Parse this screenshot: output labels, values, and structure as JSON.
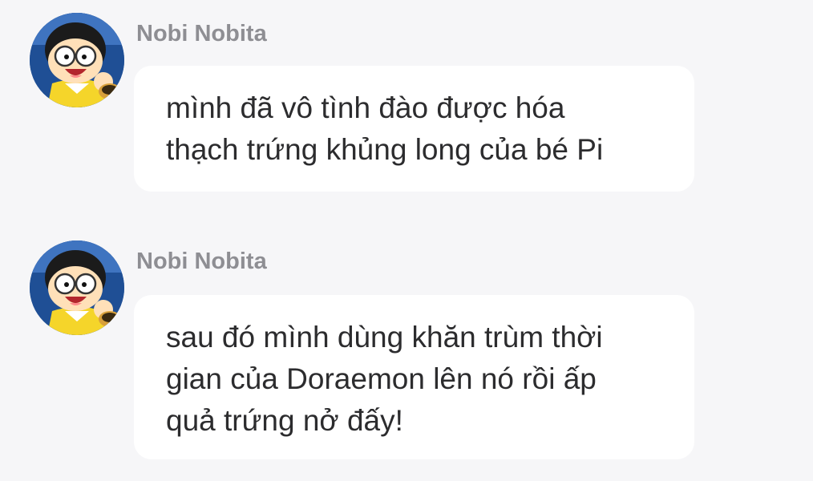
{
  "messages": [
    {
      "sender": "Nobi Nobita",
      "avatar_icon": "nobita-avatar-icon",
      "text": "mình đã vô tình đào được hóa\nthạch trứng khủng long của bé Pi"
    },
    {
      "sender": "Nobi Nobita",
      "avatar_icon": "nobita-avatar-icon",
      "text": "sau đó mình dùng khăn trùm thời\ngian của Doraemon lên nó rồi ấp\nquả trứng nở đấy!"
    }
  ],
  "colors": {
    "background": "#f6f6f8",
    "bubble": "#ffffff",
    "sender_name": "#8e8e93",
    "message_text": "#2c2c2e"
  }
}
